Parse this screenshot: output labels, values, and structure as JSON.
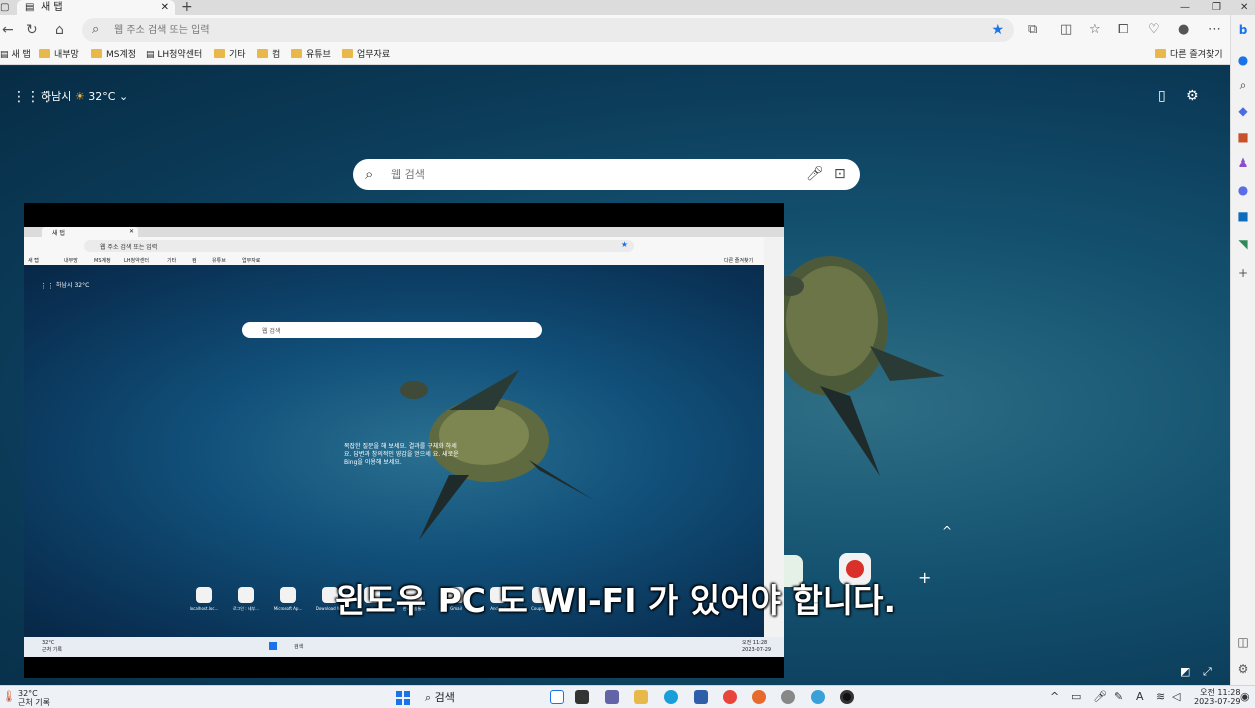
{
  "tab": {
    "title": "새 탭",
    "close": "✕",
    "new": "+"
  },
  "window": {
    "minimize": "—",
    "restore": "❐",
    "close": "✕"
  },
  "address": {
    "placeholder": "웹 주소 검색 또는 입력"
  },
  "favorites": {
    "items": [
      "새 탭",
      "내부망",
      "MS계정",
      "LH청약센터",
      "기타",
      "컴",
      "유튜브",
      "업무자료"
    ],
    "other": "다른 즐겨찾기"
  },
  "newtab": {
    "weather_city": "하남시",
    "weather_temp": "32°C",
    "search_placeholder": "웹 검색"
  },
  "video": {
    "subtitle": "윈도우 PC 도 WI-FI 가 있어야 합니다.",
    "inner_tab": "새 탭",
    "inner_address": "웹 주소 검색 또는 입력",
    "inner_favorites": [
      "새 탭",
      "내부망",
      "MS계정",
      "LH청약센터",
      "기타",
      "컴",
      "유튜브",
      "업무자료"
    ],
    "inner_other_fav": "다른 즐겨찾기",
    "inner_weather": "하남시 32°C",
    "inner_search": "웹 검색",
    "inner_bing_text": "복잡한 질문을 해 보세요. 결과를 구체화 하세요. 답변과 창의적인 영감을 얻으세 요. 새로운 Bing을 이용해 보세요.",
    "inner_apps": [
      "localhost.loc...",
      "로그인 : 네부...",
      "Microsoft Ap...",
      "Download W...",
      "U",
      "한국방송통...",
      "Gmail",
      "Android",
      "Coupang"
    ],
    "inner_taskbar_weather": "32°C\n근처 기록",
    "inner_taskbar_search": "검색",
    "inner_clock_time": "오전 11:28",
    "inner_clock_date": "2023-07-29"
  },
  "taskbar": {
    "weather_temp": "32°C",
    "weather_label": "근처 기록",
    "search": "검색",
    "time": "오전 11:28",
    "date": "2023-07-29"
  },
  "colors": {
    "accent": "#1a73e8",
    "folder": "#e8b84a",
    "page_bg": "#0c3a55"
  }
}
